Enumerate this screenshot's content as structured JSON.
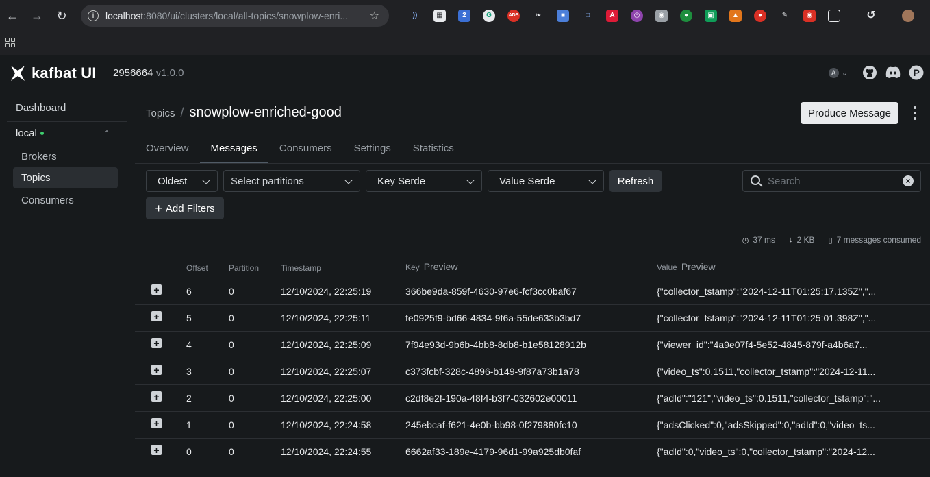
{
  "browser": {
    "url_host": "localhost",
    "url_path": ":8080/ui/clusters/local/all-topics/snowplow-enri..."
  },
  "app": {
    "brand": "kafbat UI",
    "build": "2956664",
    "version": "v1.0.0",
    "avatar_letter": "A",
    "header_icons": [
      "github-icon",
      "discord-icon",
      "product-hunt-icon"
    ]
  },
  "sidebar": {
    "dashboard": "Dashboard",
    "cluster": "local",
    "cluster_status_color": "#3ecf6f",
    "items": [
      {
        "label": "Brokers"
      },
      {
        "label": "Topics"
      },
      {
        "label": "Consumers"
      }
    ]
  },
  "page": {
    "breadcrumb_link": "Topics",
    "breadcrumb_sep": "/",
    "title": "snowplow-enriched-good",
    "produce_label": "Produce Message",
    "tabs": [
      {
        "label": "Overview"
      },
      {
        "label": "Messages"
      },
      {
        "label": "Consumers"
      },
      {
        "label": "Settings"
      },
      {
        "label": "Statistics"
      }
    ],
    "active_tab": "Messages"
  },
  "controls": {
    "seek": "Oldest",
    "partitions_placeholder": "Select partitions",
    "key_serde": "Key Serde",
    "value_serde": "Value Serde",
    "refresh": "Refresh",
    "search_placeholder": "Search",
    "add_filters": "Add Filters"
  },
  "stats": {
    "elapsed": "37 ms",
    "size": "2 KB",
    "consumed": "7 messages consumed"
  },
  "table": {
    "headers": {
      "offset": "Offset",
      "partition": "Partition",
      "timestamp": "Timestamp",
      "key": "Key",
      "key_preview": "Preview",
      "value": "Value",
      "value_preview": "Preview"
    },
    "rows": [
      {
        "offset": "6",
        "partition": "0",
        "timestamp": "12/10/2024, 22:25:19",
        "key": "366be9da-859f-4630-97e6-fcf3cc0baf67",
        "value": "{\"collector_tstamp\":\"2024-12-11T01:25:17.135Z\",\"..."
      },
      {
        "offset": "5",
        "partition": "0",
        "timestamp": "12/10/2024, 22:25:11",
        "key": "fe0925f9-bd66-4834-9f6a-55de633b3bd7",
        "value": "{\"collector_tstamp\":\"2024-12-11T01:25:01.398Z\",\"..."
      },
      {
        "offset": "4",
        "partition": "0",
        "timestamp": "12/10/2024, 22:25:09",
        "key": "7f94e93d-9b6b-4bb8-8db8-b1e58128912b",
        "value": "{\"viewer_id\":\"4a9e07f4-5e52-4845-879f-a4b6a7..."
      },
      {
        "offset": "3",
        "partition": "0",
        "timestamp": "12/10/2024, 22:25:07",
        "key": "c373fcbf-328c-4896-b149-9f87a73b1a78",
        "value": "{\"video_ts\":0.1511,\"collector_tstamp\":\"2024-12-11..."
      },
      {
        "offset": "2",
        "partition": "0",
        "timestamp": "12/10/2024, 22:25:00",
        "key": "c2df8e2f-190a-48f4-b3f7-032602e00011",
        "value": "{\"adId\":\"121\",\"video_ts\":0.1511,\"collector_tstamp\":\"..."
      },
      {
        "offset": "1",
        "partition": "0",
        "timestamp": "12/10/2024, 22:24:58",
        "key": "245ebcaf-f621-4e0b-bb98-0f279880fc10",
        "value": "{\"adsClicked\":0,\"adsSkipped\":0,\"adId\":0,\"video_ts..."
      },
      {
        "offset": "0",
        "partition": "0",
        "timestamp": "12/10/2024, 22:24:55",
        "key": "6662af33-189e-4179-96d1-99a925db0faf",
        "value": "{\"adId\":0,\"video_ts\":0,\"collector_tstamp\":\"2024-12..."
      }
    ]
  }
}
